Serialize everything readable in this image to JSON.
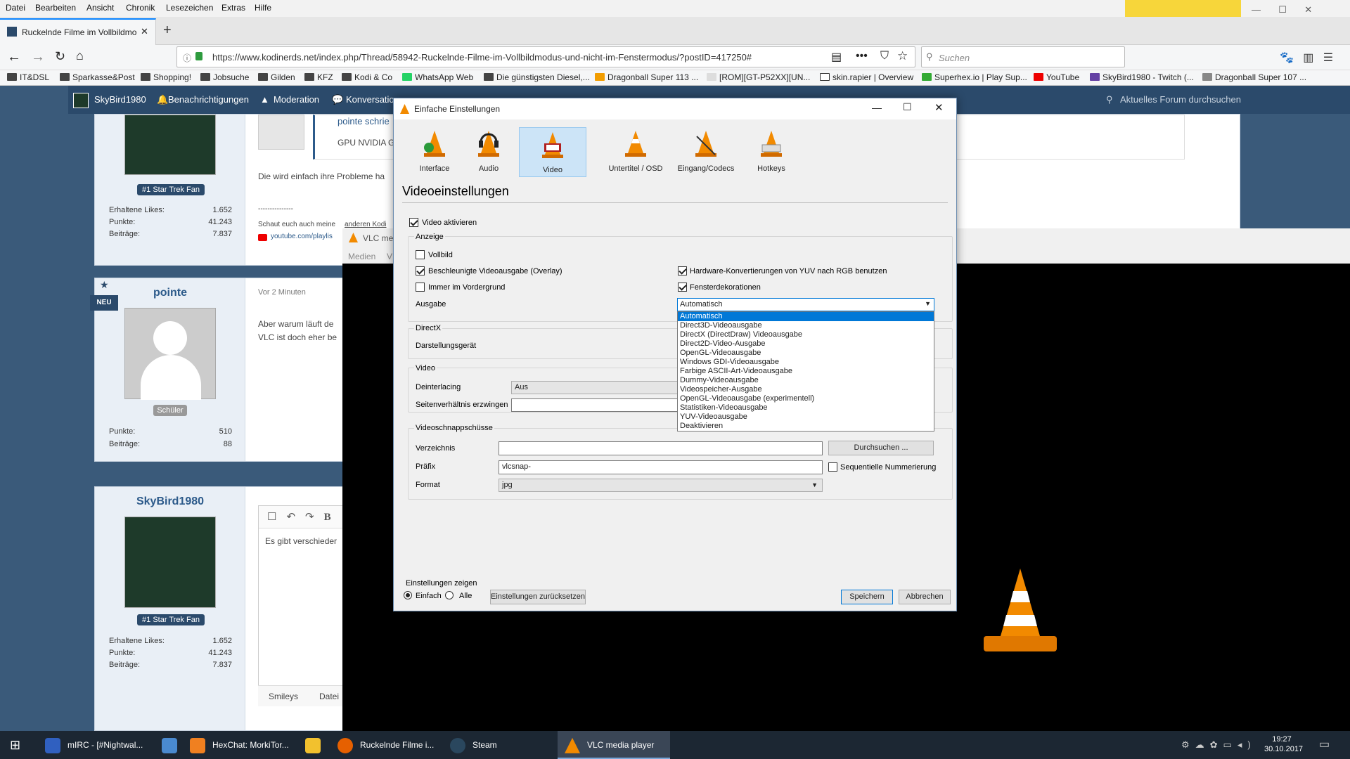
{
  "browser": {
    "menu": [
      "Datei",
      "Bearbeiten",
      "Ansicht",
      "Chronik",
      "Lesezeichen",
      "Extras",
      "Hilfe"
    ],
    "tab_title": "Ruckelnde Filme im Vollbildmo",
    "url": "https://www.kodinerds.net/index.php/Thread/58942-Ruckelnde-Filme-im-Vollbildmodus-und-nicht-im-Fenstermodus/?postID=417250#",
    "search_placeholder": "Suchen",
    "bookmarks": [
      "IT&DSL",
      "Sparkasse&Post",
      "Shopping!",
      "Jobsuche",
      "Gilden",
      "KFZ",
      "Kodi & Co",
      "WhatsApp Web",
      "Die günstigsten Diesel,...",
      "Dragonball Super 113 ...",
      "[ROM][GT-P52XX][UN...",
      "skin.rapier | Overview",
      "Superhex.io | Play Sup...",
      "YouTube",
      "SkyBird1980 - Twitch (...",
      "Dragonball Super 107 ..."
    ]
  },
  "forum": {
    "nav": {
      "user": "SkyBird1980",
      "notifications": "Benachrichtigungen",
      "moderation": "Moderation",
      "conversations": "Konversatio",
      "search": "Aktuelles Forum durchsuchen"
    },
    "post1": {
      "rank": "#1 Star Trek Fan",
      "stats": [
        {
          "label": "Erhaltene Likes:",
          "value": "1.652"
        },
        {
          "label": "Punkte:",
          "value": "41.243"
        },
        {
          "label": "Beiträge:",
          "value": "7.837"
        }
      ],
      "quote_author": "pointe schrie",
      "quote_text": "GPU NVIDIA G",
      "text": "Die wird einfach ihre Probleme ha",
      "sig_line": "---------------",
      "sig_text": "Schaut euch auch meine",
      "sig_link": "anderen Kodi",
      "sig_yt": "youtube.com/playlis"
    },
    "post2": {
      "badge": "NEU",
      "user": "pointe",
      "time": "Vor 2 Minuten",
      "rank": "Schüler",
      "stats": [
        {
          "label": "Punkte:",
          "value": "510"
        },
        {
          "label": "Beiträge:",
          "value": "88"
        }
      ],
      "line1": "Aber warum läuft de",
      "line2": "VLC ist doch eher be"
    },
    "post3": {
      "user": "SkyBird1980",
      "rank": "#1 Star Trek Fan",
      "stats": [
        {
          "label": "Erhaltene Likes:",
          "value": "1.652"
        },
        {
          "label": "Punkte:",
          "value": "41.243"
        },
        {
          "label": "Beiträge:",
          "value": "7.837"
        }
      ],
      "editor_text": "Es gibt verschieder",
      "tabs": [
        "Smileys",
        "Datei"
      ]
    }
  },
  "vlc_main": {
    "title": "VLC me",
    "menu": [
      "Medien",
      "V"
    ]
  },
  "dialog": {
    "title": "Einfache Einstellungen",
    "categories": [
      "Interface",
      "Audio",
      "Video",
      "Untertitel / OSD",
      "Eingang/Codecs",
      "Hotkeys"
    ],
    "selected_category": "Video",
    "heading": "Videoeinstellungen",
    "video_enable": "Video aktivieren",
    "group_display": "Anzeige",
    "fullscreen": "Vollbild",
    "overlay": "Beschleunigte Videoausgabe (Overlay)",
    "ontop": "Immer im Vordergrund",
    "yuv": "Hardware-Konvertierungen von YUV nach RGB benutzen",
    "decorations": "Fensterdekorationen",
    "output_label": "Ausgabe",
    "output_value": "Automatisch",
    "output_options": [
      "Automatisch",
      "Direct3D-Videoausgabe",
      "DirectX (DirectDraw) Videoausgabe",
      "Direct2D-Video-Ausgabe",
      "OpenGL-Videoausgabe",
      "Windows GDI-Videoausgabe",
      "Farbige ASCII-Art-Videoausgabe",
      "Dummy-Videoausgabe",
      "Videospeicher-Ausgabe",
      "OpenGL-Videoausgabe (experimentell)",
      "Statistiken-Videoausgabe",
      "YUV-Videoausgabe",
      "Deaktivieren"
    ],
    "group_directx": "DirectX",
    "device_label": "Darstellungsgerät",
    "group_video": "Video",
    "deinterlace_label": "Deinterlacing",
    "deinterlace_value": "Aus",
    "aspect_label": "Seitenverhältnis erzwingen",
    "group_snap": "Videoschnappschüsse",
    "dir_label": "Verzeichnis",
    "browse": "Durchsuchen ...",
    "prefix_label": "Präfix",
    "prefix_value": "vlcsnap-",
    "sequential": "Sequentielle Nummerierung",
    "format_label": "Format",
    "format_value": "jpg",
    "show_settings": "Einstellungen zeigen",
    "simple": "Einfach",
    "all": "Alle",
    "reset": "Einstellungen zurücksetzen",
    "save": "Speichern",
    "cancel": "Abbrechen"
  },
  "taskbar": {
    "items": [
      "mIRC - [#Nightwal...",
      "HexChat: MorkiTor...",
      "Ruckelnde Filme i...",
      "Steam",
      "VLC media player"
    ],
    "time": "19:27",
    "date": "30.10.2017"
  },
  "colors": {
    "accent": "#0078d7",
    "forum_dark": "#2b4a6b",
    "vlc_orange": "#f28a00"
  }
}
